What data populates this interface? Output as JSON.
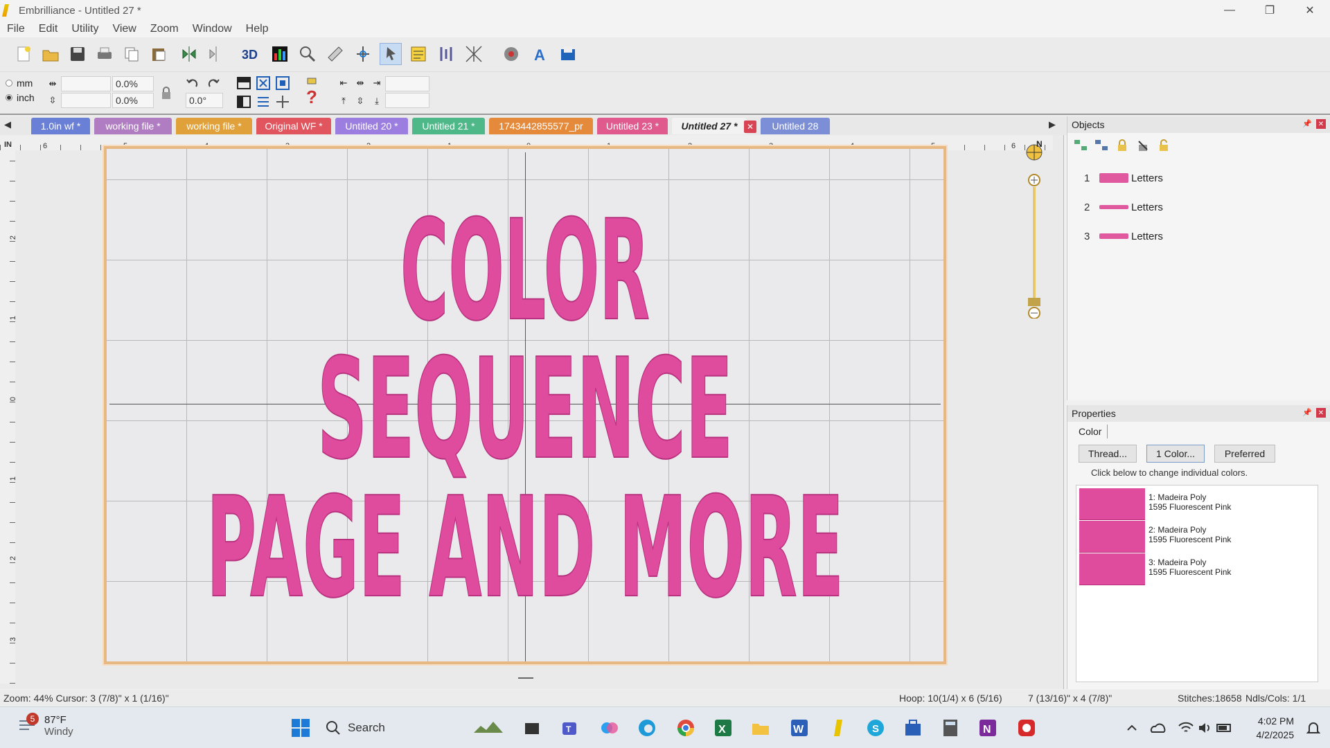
{
  "app": {
    "title": "Embrilliance - Untitled 27 *",
    "window_controls": [
      "—",
      "❐",
      "✕"
    ]
  },
  "menu": [
    "File",
    "Edit",
    "Utility",
    "View",
    "Zoom",
    "Window",
    "Help"
  ],
  "toolbar2": {
    "unit_mm": "mm",
    "unit_inch": "inch",
    "selected_unit": "inch",
    "width_pct": "0.0%",
    "height_pct": "0.0%",
    "rotation": "0.0°"
  },
  "tabs": [
    {
      "label": "1.0in wf *",
      "color": "#6a7fd6"
    },
    {
      "label": "working file *",
      "color": "#b07cc2"
    },
    {
      "label": "working file *",
      "color": "#e0a03a"
    },
    {
      "label": "Original WF *",
      "color": "#e0555e"
    },
    {
      "label": "Untitled 20 *",
      "color": "#9c7ee0"
    },
    {
      "label": "Untitled 21 *",
      "color": "#4fb889"
    },
    {
      "label": "1743442855577_pr",
      "color": "#e58a3b"
    },
    {
      "label": "Untitled 23 *",
      "color": "#e05a8d"
    },
    {
      "label": "Untitled 27 *",
      "color": "#f2f2f2",
      "active": true
    },
    {
      "label": "Untitled 28",
      "color": "#7c8fd6"
    }
  ],
  "ruler": {
    "unit": "IN",
    "h_labels": [
      "6",
      "5",
      "4",
      "3",
      "2",
      "1",
      "0",
      "1",
      "2",
      "3",
      "4",
      "5",
      "6"
    ],
    "v_labels": [
      "2",
      "1",
      "0",
      "1",
      "2",
      "3"
    ]
  },
  "design": {
    "lines": [
      "COLOR",
      "SEQUENCE",
      "PAGE AND MORE"
    ],
    "thread_color": "#df4c9e"
  },
  "objects_panel": {
    "title": "Objects",
    "items": [
      {
        "num": "1",
        "label": "Letters"
      },
      {
        "num": "2",
        "label": "Letters"
      },
      {
        "num": "3",
        "label": "Letters"
      }
    ]
  },
  "properties_panel": {
    "title": "Properties",
    "tab": "Color",
    "buttons": [
      "Thread...",
      "1 Color...",
      "Preferred"
    ],
    "hint": "Click below to change individual colors.",
    "colors": [
      {
        "line1": "1: Madeira Poly",
        "line2": "1595 Fluorescent Pink"
      },
      {
        "line1": "2: Madeira Poly",
        "line2": "1595 Fluorescent Pink"
      },
      {
        "line1": "3: Madeira Poly",
        "line2": "1595 Fluorescent Pink"
      }
    ]
  },
  "status": {
    "zoom_cursor": "Zoom: 44%  Cursor: 3 (7/8)\" x 1 (1/16)\"",
    "hoop": "Hoop: 10(1/4) x 6 (5/16)",
    "size": "7 (13/16)\" x 4 (7/8)\"",
    "stitches": "Stitches:18658",
    "ndls": "Ndls/Cols: 1/1"
  },
  "taskbar": {
    "weather_badge": "5",
    "temp": "87°F",
    "condition": "Windy",
    "search": "Search",
    "time": "4:02 PM",
    "date": "4/2/2025"
  }
}
